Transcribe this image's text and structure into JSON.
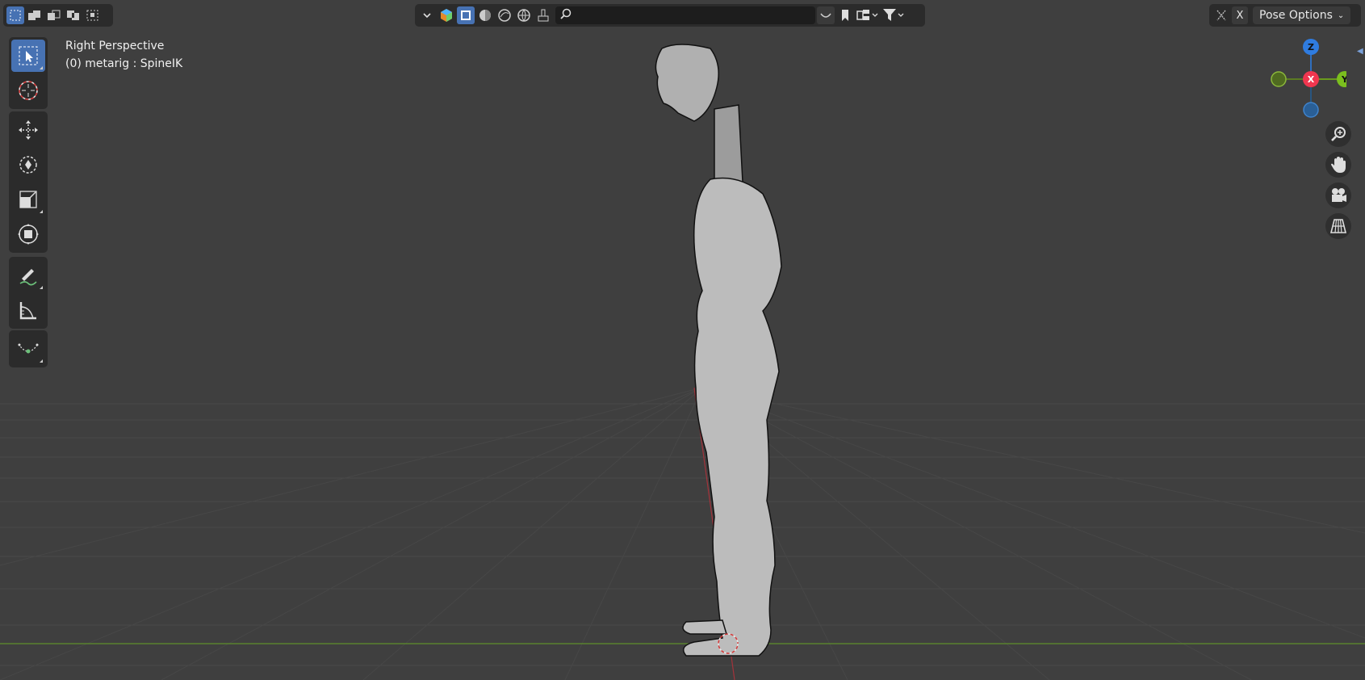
{
  "header": {
    "select_modes": [
      "select-new",
      "select-extend",
      "select-subtract",
      "select-invert",
      "select-intersect"
    ],
    "search": {
      "value": "",
      "placeholder": ""
    },
    "x_label": "X",
    "pose_options_label": "Pose Options"
  },
  "viewport": {
    "view_name": "Right Perspective",
    "object_info": "(0) metarig : SpineIK"
  },
  "gizmo": {
    "z_label": "Z",
    "x_label": "X",
    "y_label": "Y",
    "colors": {
      "x": "#ff3352",
      "y": "#8bdc00",
      "z": "#2890ff"
    }
  },
  "toolbar": {
    "tools": [
      "select-box",
      "cursor",
      "move",
      "rotate",
      "scale",
      "transform",
      "annotate",
      "measure",
      "bend"
    ]
  },
  "navigation": [
    "zoom",
    "pan",
    "camera-view",
    "toggle-perspective"
  ]
}
